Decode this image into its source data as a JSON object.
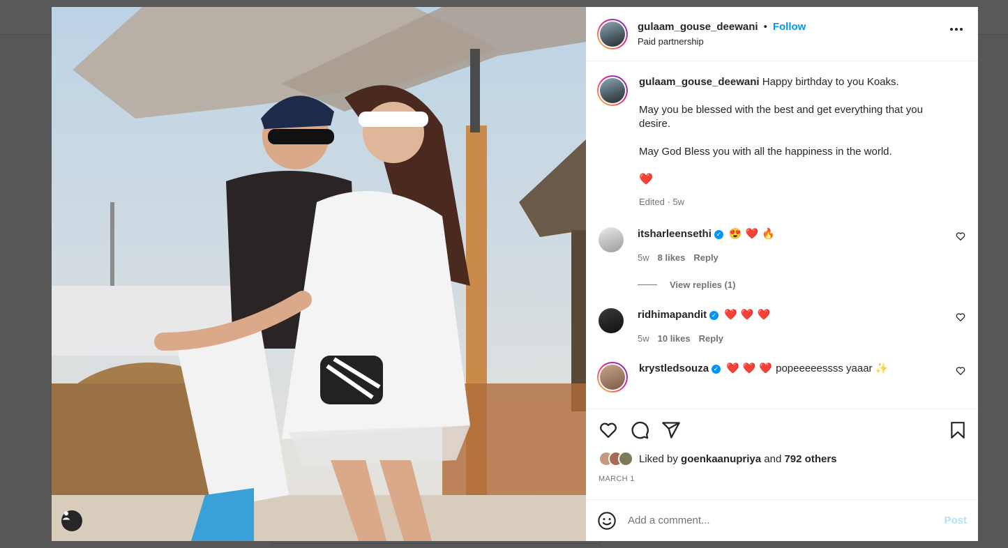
{
  "post": {
    "author": "gulaam_gouse_deewani",
    "separator": "•",
    "follow_label": "Follow",
    "subtitle": "Paid partnership",
    "caption": {
      "username": "gulaam_gouse_deewani",
      "line1": "Happy birthday to you Koaks.",
      "line2": "May you be blessed with the best and get everything that you desire.",
      "line3": "May God Bless you with all the happiness in the world.",
      "heart": "❤️",
      "meta": "Edited · 5w"
    },
    "comments": [
      {
        "username": "itsharleensethi",
        "verified": true,
        "emojis": [
          "😍",
          "❤️",
          "🔥"
        ],
        "text": "",
        "time": "5w",
        "likes": "8 likes",
        "reply_label": "Reply"
      },
      {
        "username": "ridhimapandit",
        "verified": true,
        "emojis": [
          "❤️",
          "❤️",
          "❤️"
        ],
        "text": "",
        "time": "5w",
        "likes": "10 likes",
        "reply_label": "Reply"
      },
      {
        "username": "krystledsouza",
        "verified": true,
        "emojis": [
          "❤️",
          "❤️",
          "❤️"
        ],
        "text": "popeeeeessss yaaar ✨",
        "time": "",
        "likes": "",
        "reply_label": ""
      }
    ],
    "view_replies": "View replies (1)",
    "liked_by_prefix": "Liked by",
    "liked_by_user": "goenkaanupriya",
    "liked_by_and": "and",
    "liked_by_others": "792 others",
    "date": "MARCH 1",
    "add_comment_placeholder": "Add a comment...",
    "post_label": "Post"
  },
  "colors": {
    "accent": "#0095f6",
    "verified": "#0095f6",
    "heart": "#ed4956",
    "post_disabled": "#b2dffc"
  },
  "icons": {
    "actions": [
      "heart-icon",
      "comment-icon",
      "share-icon"
    ],
    "save": "bookmark-icon",
    "more": "more-options-icon",
    "emoji": "emoji-icon",
    "user_tag": "user-tag-icon"
  }
}
